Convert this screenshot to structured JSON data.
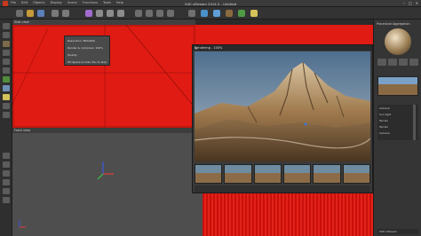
{
  "window": {
    "title": "VUE xStream 2014.5 - Untitled",
    "menu": [
      "File",
      "Edit",
      "Objects",
      "Display",
      "Scene",
      "Functions",
      "Tools",
      "Help"
    ],
    "controls": [
      "–",
      "□",
      "×"
    ]
  },
  "toolbar": {
    "icons": [
      "new-file-icon",
      "open-icon",
      "save-icon",
      "undo-icon",
      "redo-icon",
      "cut-icon",
      "copy-icon",
      "paste-icon",
      "delete-icon",
      "select-icon",
      "move-icon",
      "rotate-icon",
      "scale-icon",
      "camera-icon",
      "render-icon",
      "atmosphere-icon",
      "terrain-icon",
      "plant-icon",
      "light-icon"
    ]
  },
  "viewports": {
    "top": {
      "label": "Side view"
    },
    "bottom": {
      "label": "Front view"
    }
  },
  "popup": {
    "rows": [
      "Resolution: 800x600",
      "Render & compress: 100%",
      "Quality",
      "Hit Space to hide, Esc to stop"
    ]
  },
  "render_window": {
    "title": "Rendering - 100%",
    "close": "×",
    "thumbnail_count": 6
  },
  "right_panel": {
    "title": "Procedural Aggregation",
    "list_rows": [
      "Camera",
      "Sun light",
      "Terrain",
      "Terrain",
      "Camera"
    ],
    "bottom_label": "VUE xStream"
  },
  "colors": {
    "viewport_red": "#e01b13",
    "background": "#2b2b2b",
    "panel": "#353535"
  }
}
